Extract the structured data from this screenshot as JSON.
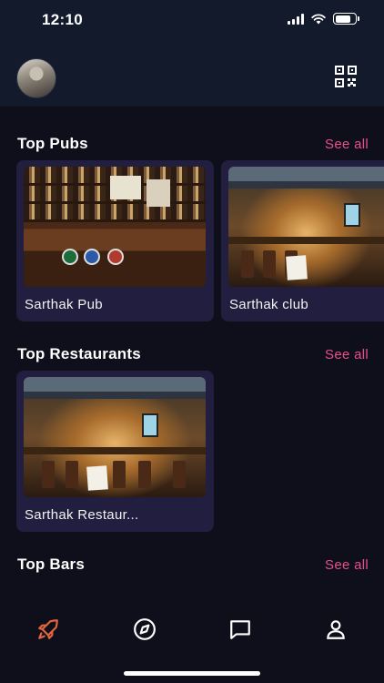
{
  "status_bar": {
    "time": "12:10",
    "battery_level": 0.8
  },
  "sections": [
    {
      "title": "Top Pubs",
      "see_all": "See all",
      "cards": [
        {
          "label": "Sarthak Pub"
        },
        {
          "label": "Sarthak club"
        }
      ]
    },
    {
      "title": "Top Restaurants",
      "see_all": "See all",
      "cards": [
        {
          "label": "Sarthak Restaur..."
        }
      ]
    },
    {
      "title": "Top Bars",
      "see_all": "See all",
      "cards": []
    }
  ],
  "tab_bar": {
    "items": [
      {
        "icon": "rocket-icon",
        "active": true
      },
      {
        "icon": "compass-icon",
        "active": false
      },
      {
        "icon": "chat-icon",
        "active": false
      },
      {
        "icon": "profile-icon",
        "active": false
      }
    ]
  },
  "colors": {
    "background": "#0f0f1c",
    "header": "#131a2c",
    "card": "#221e3f",
    "accent": "#e8508a",
    "active_tab": "#e0663c"
  }
}
